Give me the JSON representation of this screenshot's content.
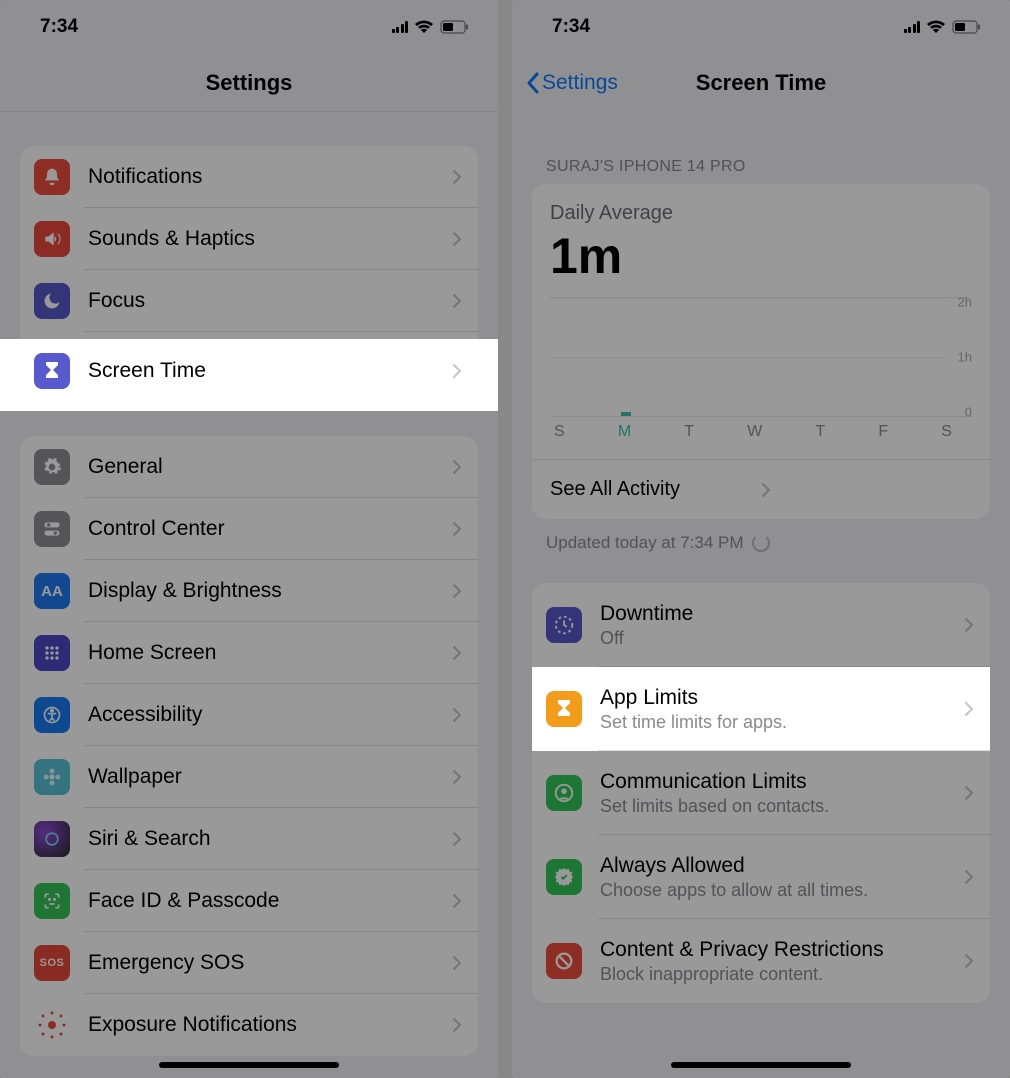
{
  "status": {
    "time": "7:34"
  },
  "left": {
    "title": "Settings",
    "group1": [
      {
        "key": "notifications",
        "label": "Notifications",
        "color": "ic-red"
      },
      {
        "key": "sounds",
        "label": "Sounds & Haptics",
        "color": "ic-red2"
      },
      {
        "key": "focus",
        "label": "Focus",
        "color": "ic-indigo"
      },
      {
        "key": "screentime",
        "label": "Screen Time",
        "color": "ic-purple"
      }
    ],
    "group2": [
      {
        "key": "general",
        "label": "General",
        "color": "ic-gray"
      },
      {
        "key": "control",
        "label": "Control Center",
        "color": "ic-gray"
      },
      {
        "key": "display",
        "label": "Display & Brightness",
        "color": "ic-blue"
      },
      {
        "key": "home",
        "label": "Home Screen",
        "color": "ic-home"
      },
      {
        "key": "accessibility",
        "label": "Accessibility",
        "color": "ic-blue2"
      },
      {
        "key": "wallpaper",
        "label": "Wallpaper",
        "color": "ic-cyan"
      },
      {
        "key": "siri",
        "label": "Siri & Search",
        "color": "ic-siri"
      },
      {
        "key": "faceid",
        "label": "Face ID & Passcode",
        "color": "ic-green"
      },
      {
        "key": "sos",
        "label": "Emergency SOS",
        "color": "ic-sos"
      },
      {
        "key": "exposure",
        "label": "Exposure Notifications",
        "color": "ic-dotred"
      }
    ]
  },
  "right": {
    "back": "Settings",
    "title": "Screen Time",
    "section_header": "SURAJ'S IPHONE 14 PRO",
    "daily_average_label": "Daily Average",
    "daily_average_value": "1m",
    "y_ticks": [
      "2h",
      "1h",
      "0"
    ],
    "days": [
      "S",
      "M",
      "T",
      "W",
      "T",
      "F",
      "S"
    ],
    "see_all": "See All Activity",
    "updated": "Updated today at 7:34 PM",
    "rows": [
      {
        "key": "downtime",
        "label": "Downtime",
        "sub": "Off",
        "color": "ic-indigo"
      },
      {
        "key": "applimits",
        "label": "App Limits",
        "sub": "Set time limits for apps.",
        "color": "ic-orange"
      },
      {
        "key": "commlimits",
        "label": "Communication Limits",
        "sub": "Set limits based on contacts.",
        "color": "ic-green2"
      },
      {
        "key": "always",
        "label": "Always Allowed",
        "sub": "Choose apps to allow at all times.",
        "color": "ic-green2"
      },
      {
        "key": "content",
        "label": "Content & Privacy Restrictions",
        "sub": "Block inappropriate content.",
        "color": "ic-red"
      }
    ]
  },
  "chart_data": {
    "type": "bar",
    "categories": [
      "S",
      "M",
      "T",
      "W",
      "T",
      "F",
      "S"
    ],
    "values": [
      0,
      0.05,
      0,
      0,
      0,
      0,
      0
    ],
    "title": "Daily Average",
    "xlabel": "",
    "ylabel": "hours",
    "ylim": [
      0,
      2
    ],
    "y_ticks": [
      0,
      1,
      2
    ]
  }
}
